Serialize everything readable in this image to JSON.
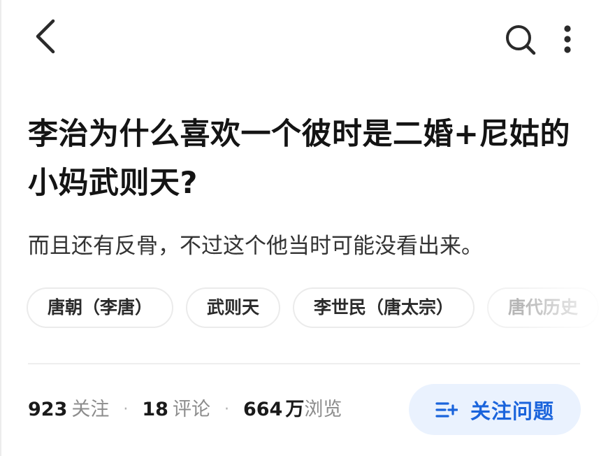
{
  "header": {
    "back_icon": "chevron-left-icon",
    "search_icon": "search-icon",
    "more_icon": "more-vertical-icon"
  },
  "question": {
    "title": "李治为什么喜欢一个彼时是二婚+尼姑的小妈武则天?",
    "description": "而且还有反骨，不过这个他当时可能没看出来。"
  },
  "topics": [
    {
      "label": "唐朝（李唐）"
    },
    {
      "label": "武则天"
    },
    {
      "label": "李世民（唐太宗）"
    },
    {
      "label": "唐代历史"
    }
  ],
  "stats": {
    "followers": {
      "value": "923",
      "label": "关注"
    },
    "comments": {
      "value": "18",
      "label": "评论"
    },
    "views": {
      "value": "664",
      "unit": "万",
      "label": "浏览"
    },
    "separator": "·"
  },
  "follow_button": {
    "label": "关注问题",
    "icon": "add-to-list-icon"
  },
  "colors": {
    "accent": "#1a64dc",
    "button_bg": "#eaf2fe",
    "text_primary": "#141414",
    "text_secondary": "#8c8c8c"
  }
}
